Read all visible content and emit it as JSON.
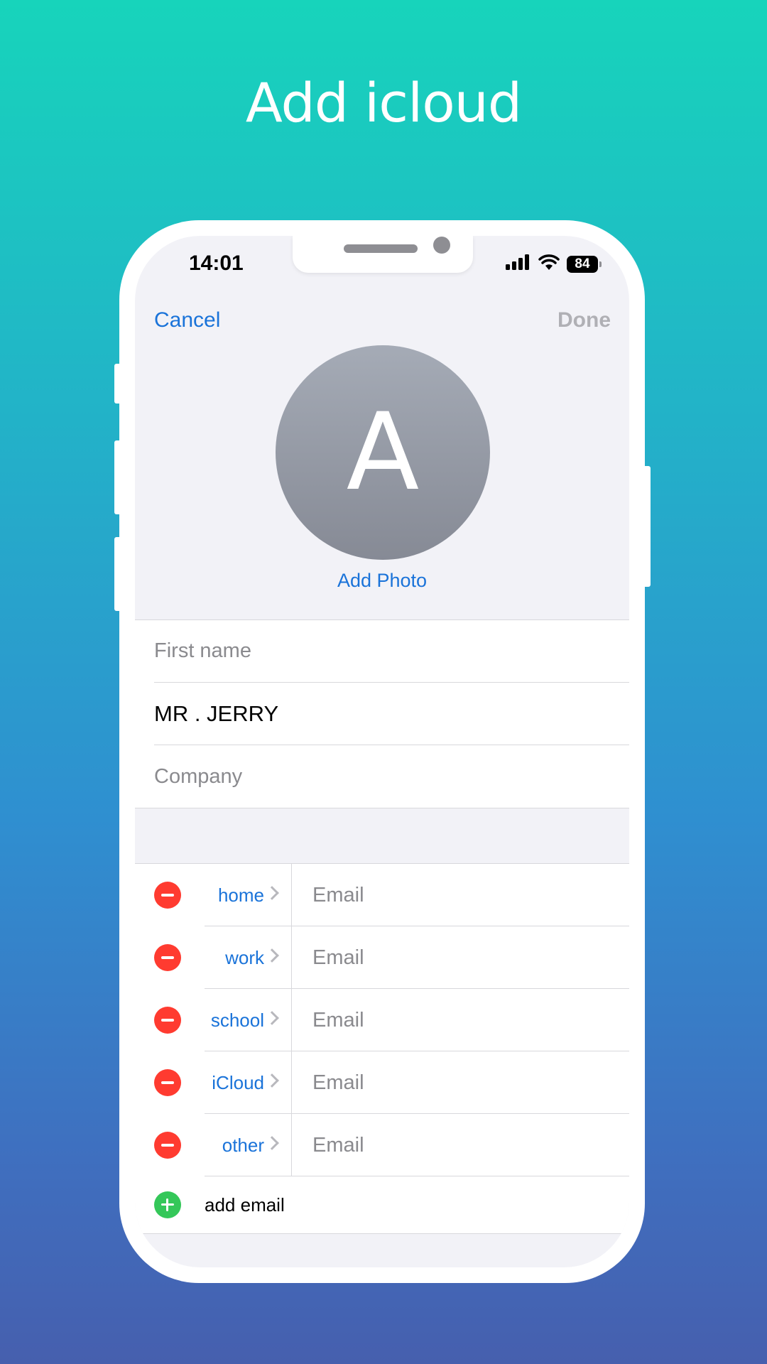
{
  "headline": "Add icloud",
  "status_bar": {
    "time": "14:01",
    "battery": "84"
  },
  "nav": {
    "cancel": "Cancel",
    "done": "Done"
  },
  "avatar": {
    "initial": "A",
    "add_photo": "Add Photo"
  },
  "name_fields": {
    "first_name_placeholder": "First name",
    "last_name_value": "MR . JERRY",
    "company_placeholder": "Company"
  },
  "emails": [
    {
      "label": "home",
      "placeholder": "Email"
    },
    {
      "label": "work",
      "placeholder": "Email"
    },
    {
      "label": "school",
      "placeholder": "Email"
    },
    {
      "label": "iCloud",
      "placeholder": "Email"
    },
    {
      "label": "other",
      "placeholder": "Email"
    }
  ],
  "add_email": "add email",
  "colors": {
    "accent": "#1a73d9",
    "delete": "#ff3b30",
    "add": "#34c759",
    "gradient_top": "#17d4bb",
    "gradient_bottom": "#465fae"
  }
}
